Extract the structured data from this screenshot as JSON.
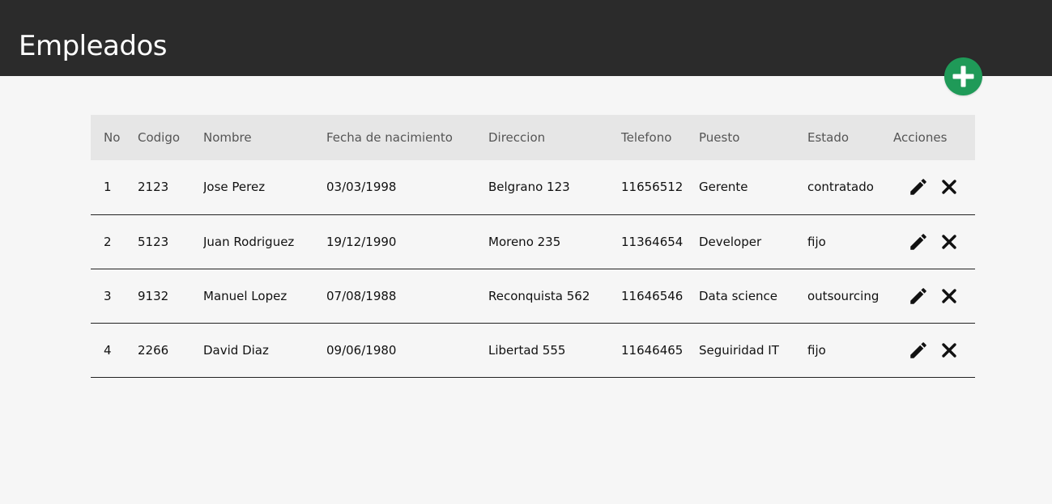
{
  "header": {
    "title": "Empleados",
    "background": "#2b2b2b"
  },
  "add_button": {
    "icon": "plus-icon",
    "color": "#1f9a58"
  },
  "table": {
    "columns": [
      "No",
      "Codigo",
      "Nombre",
      "Fecha de nacimiento",
      "Direccion",
      "Telefono",
      "Puesto",
      "Estado",
      "Acciones"
    ],
    "rows": [
      {
        "no": "1",
        "codigo": "2123",
        "nombre": "Jose Perez",
        "fecha": "03/03/1998",
        "direccion": "Belgrano 123",
        "telefono": "11656512",
        "puesto": "Gerente",
        "estado": "contratado"
      },
      {
        "no": "2",
        "codigo": "5123",
        "nombre": "Juan Rodriguez",
        "fecha": "19/12/1990",
        "direccion": "Moreno 235",
        "telefono": "11364654",
        "puesto": "Developer",
        "estado": "fijo"
      },
      {
        "no": "3",
        "codigo": "9132",
        "nombre": "Manuel Lopez",
        "fecha": "07/08/1988",
        "direccion": "Reconquista 562",
        "telefono": "11646546",
        "puesto": "Data science",
        "estado": "outsourcing"
      },
      {
        "no": "4",
        "codigo": "2266",
        "nombre": "David Diaz",
        "fecha": "09/06/1980",
        "direccion": "Libertad 555",
        "telefono": "11646465",
        "puesto": "Seguiridad IT",
        "estado": "fijo"
      }
    ],
    "row_actions": [
      "edit-icon",
      "close-icon"
    ]
  }
}
